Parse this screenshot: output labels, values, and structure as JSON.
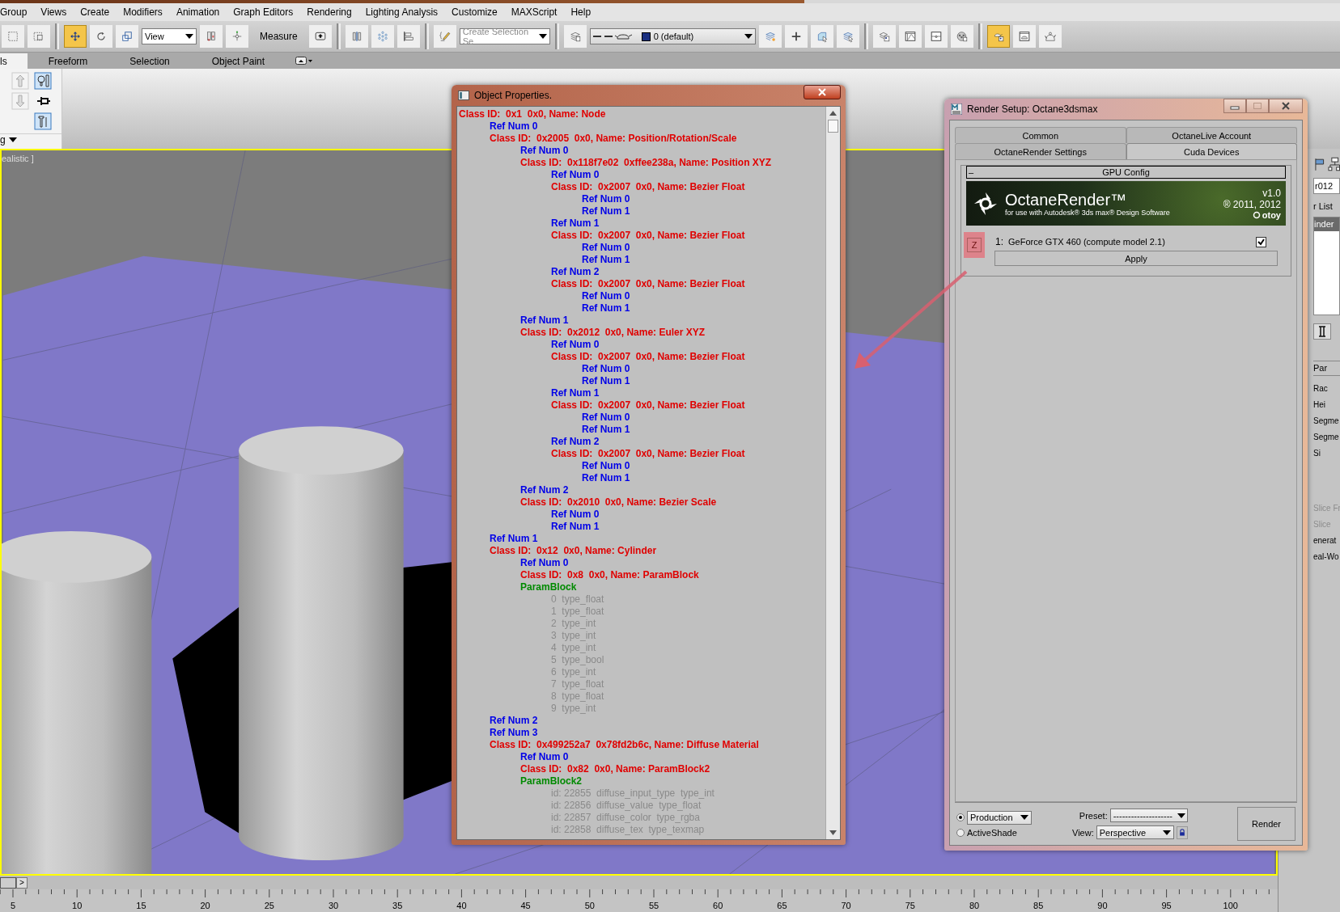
{
  "menu_bar": {
    "items": [
      "Group",
      "Views",
      "Create",
      "Modifiers",
      "Animation",
      "Graph Editors",
      "Rendering",
      "Lighting Analysis",
      "Customize",
      "MAXScript",
      "Help"
    ]
  },
  "main_toolbar": {
    "items": [
      {
        "kind": "icon",
        "selected": false
      },
      {
        "kind": "icon",
        "selected": false
      },
      {
        "kind": "separator"
      },
      {
        "kind": "icon",
        "selected": true
      },
      {
        "kind": "icon",
        "selected": false
      },
      {
        "kind": "icon",
        "selected": false
      },
      {
        "kind": "dropdown",
        "text": "View"
      },
      {
        "kind": "icon",
        "selected": false
      },
      {
        "kind": "icon",
        "selected": false
      },
      {
        "kind": "label",
        "text": "Measure"
      },
      {
        "kind": "icon",
        "selected": false
      },
      {
        "kind": "separator"
      },
      {
        "kind": "icon",
        "selected": false
      },
      {
        "kind": "icon",
        "selected": false
      },
      {
        "kind": "icon",
        "selected": false
      },
      {
        "kind": "separator"
      },
      {
        "kind": "icon",
        "selected": false
      },
      {
        "kind": "dropdown",
        "placeholder": "Create Selection Se"
      },
      {
        "kind": "separator"
      },
      {
        "kind": "icon",
        "selected": false
      },
      {
        "kind": "layer-dropdown",
        "text": "0 (default)"
      },
      {
        "kind": "icon",
        "selected": false
      },
      {
        "kind": "icon",
        "selected": false
      },
      {
        "kind": "icon",
        "selected": false
      },
      {
        "kind": "icon",
        "selected": false
      },
      {
        "kind": "separator"
      },
      {
        "kind": "icon",
        "selected": false
      },
      {
        "kind": "icon",
        "selected": false
      },
      {
        "kind": "icon",
        "selected": false
      },
      {
        "kind": "icon",
        "selected": false
      },
      {
        "kind": "separator"
      },
      {
        "kind": "icon",
        "selected": true
      },
      {
        "kind": "icon",
        "selected": false
      },
      {
        "kind": "icon",
        "selected": false
      }
    ]
  },
  "ribbon": {
    "tabs": [
      {
        "label": "ls",
        "selected": true
      },
      {
        "label": "Freeform",
        "selected": false
      },
      {
        "label": "Selection",
        "selected": false
      },
      {
        "label": "Object Paint",
        "selected": false
      }
    ],
    "panel_label": "g"
  },
  "viewport": {
    "label": "ealistic ]"
  },
  "object_properties": {
    "title": "Object Properties.",
    "tree": [
      {
        "kind": "class",
        "text": "Class ID:  0x1  0x0, Name: Node",
        "children": [
          {
            "kind": "ref",
            "text": "Ref Num 0"
          },
          {
            "kind": "class",
            "text": "Class ID:  0x2005  0x0, Name: Position/Rotation/Scale",
            "children": [
              {
                "kind": "ref",
                "text": "Ref Num 0"
              },
              {
                "kind": "class",
                "text": "Class ID:  0x118f7e02  0xffee238a, Name: Position XYZ",
                "children": [
                  {
                    "kind": "ref",
                    "text": "Ref Num 0"
                  },
                  {
                    "kind": "class",
                    "text": "Class ID:  0x2007  0x0, Name: Bezier Float",
                    "children": [
                      {
                        "kind": "ref",
                        "text": "Ref Num 0"
                      },
                      {
                        "kind": "ref",
                        "text": "Ref Num 1"
                      }
                    ]
                  },
                  {
                    "kind": "ref",
                    "text": "Ref Num 1"
                  },
                  {
                    "kind": "class",
                    "text": "Class ID:  0x2007  0x0, Name: Bezier Float",
                    "children": [
                      {
                        "kind": "ref",
                        "text": "Ref Num 0"
                      },
                      {
                        "kind": "ref",
                        "text": "Ref Num 1"
                      }
                    ]
                  },
                  {
                    "kind": "ref",
                    "text": "Ref Num 2"
                  },
                  {
                    "kind": "class",
                    "text": "Class ID:  0x2007  0x0, Name: Bezier Float",
                    "children": [
                      {
                        "kind": "ref",
                        "text": "Ref Num 0"
                      },
                      {
                        "kind": "ref",
                        "text": "Ref Num 1"
                      }
                    ]
                  }
                ]
              },
              {
                "kind": "ref",
                "text": "Ref Num 1"
              },
              {
                "kind": "class",
                "text": "Class ID:  0x2012  0x0, Name: Euler XYZ",
                "children": [
                  {
                    "kind": "ref",
                    "text": "Ref Num 0"
                  },
                  {
                    "kind": "class",
                    "text": "Class ID:  0x2007  0x0, Name: Bezier Float",
                    "children": [
                      {
                        "kind": "ref",
                        "text": "Ref Num 0"
                      },
                      {
                        "kind": "ref",
                        "text": "Ref Num 1"
                      }
                    ]
                  },
                  {
                    "kind": "ref",
                    "text": "Ref Num 1"
                  },
                  {
                    "kind": "class",
                    "text": "Class ID:  0x2007  0x0, Name: Bezier Float",
                    "children": [
                      {
                        "kind": "ref",
                        "text": "Ref Num 0"
                      },
                      {
                        "kind": "ref",
                        "text": "Ref Num 1"
                      }
                    ]
                  },
                  {
                    "kind": "ref",
                    "text": "Ref Num 2"
                  },
                  {
                    "kind": "class",
                    "text": "Class ID:  0x2007  0x0, Name: Bezier Float",
                    "children": [
                      {
                        "kind": "ref",
                        "text": "Ref Num 0"
                      },
                      {
                        "kind": "ref",
                        "text": "Ref Num 1"
                      }
                    ]
                  }
                ]
              },
              {
                "kind": "ref",
                "text": "Ref Num 2"
              },
              {
                "kind": "class",
                "text": "Class ID:  0x2010  0x0, Name: Bezier Scale",
                "children": [
                  {
                    "kind": "ref",
                    "text": "Ref Num 0"
                  },
                  {
                    "kind": "ref",
                    "text": "Ref Num 1"
                  }
                ]
              }
            ]
          },
          {
            "kind": "ref",
            "text": "Ref Num 1"
          },
          {
            "kind": "class",
            "text": "Class ID:  0x12  0x0, Name: Cylinder",
            "children": [
              {
                "kind": "ref",
                "text": "Ref Num 0"
              },
              {
                "kind": "class",
                "text": "Class ID:  0x8  0x0, Name: ParamBlock"
              },
              {
                "kind": "param",
                "text": "ParamBlock",
                "children": [
                  {
                    "kind": "field",
                    "text": "0  type_float"
                  },
                  {
                    "kind": "field",
                    "text": "1  type_float"
                  },
                  {
                    "kind": "field",
                    "text": "2  type_int"
                  },
                  {
                    "kind": "field",
                    "text": "3  type_int"
                  },
                  {
                    "kind": "field",
                    "text": "4  type_int"
                  },
                  {
                    "kind": "field",
                    "text": "5  type_bool"
                  },
                  {
                    "kind": "field",
                    "text": "6  type_int"
                  },
                  {
                    "kind": "field",
                    "text": "7  type_float"
                  },
                  {
                    "kind": "field",
                    "text": "8  type_float"
                  },
                  {
                    "kind": "field",
                    "text": "9  type_int"
                  }
                ]
              }
            ]
          },
          {
            "kind": "ref",
            "text": "Ref Num 2"
          },
          {
            "kind": "ref",
            "text": "Ref Num 3"
          },
          {
            "kind": "class",
            "text": "Class ID:  0x499252a7  0x78fd2b6c, Name: Diffuse Material",
            "children": [
              {
                "kind": "ref",
                "text": "Ref Num 0"
              },
              {
                "kind": "class",
                "text": "Class ID:  0x82  0x0, Name: ParamBlock2"
              },
              {
                "kind": "param",
                "text": "ParamBlock2",
                "children": [
                  {
                    "kind": "field",
                    "text": "id: 22855  diffuse_input_type  type_int"
                  },
                  {
                    "kind": "field",
                    "text": "id: 22856  diffuse_value  type_float"
                  },
                  {
                    "kind": "field",
                    "text": "id: 22857  diffuse_color  type_rgba"
                  },
                  {
                    "kind": "field",
                    "text": "id: 22858  diffuse_tex  type_texmap"
                  }
                ]
              }
            ]
          }
        ]
      }
    ]
  },
  "render_setup": {
    "title": "Render Setup: Octane3dsmax",
    "tab_rows": [
      {
        "tabs": [
          {
            "label": "Common",
            "selected": false
          },
          {
            "label": "OctaneLive Account",
            "selected": false
          }
        ]
      },
      {
        "tabs": [
          {
            "label": "OctaneRender Settings",
            "selected": false
          },
          {
            "label": "Cuda Devices",
            "selected": true
          }
        ]
      }
    ],
    "rollout": {
      "collapse": "–",
      "title": "GPU Config",
      "banner": {
        "product": "OctaneRender™",
        "subtitle": "for use with Autodesk® 3ds max® Design Software",
        "version": "v1.0",
        "copyright": "® 2011, 2012",
        "company": "otoy"
      },
      "devices": [
        {
          "index": "1:",
          "name": "GeForce GTX 460 (compute model 2.1)",
          "checked": true
        }
      ],
      "apply": "Apply"
    },
    "annotation": {
      "label": "Z"
    },
    "modes": [
      {
        "kind": "dropdown",
        "label": "Production",
        "selected": true
      },
      {
        "kind": "text",
        "label": "ActiveShade",
        "selected": false
      }
    ],
    "preset": {
      "label": "Preset:",
      "value": "--------------------"
    },
    "view": {
      "label": "View:",
      "value": "Perspective"
    },
    "render_button": "Render"
  },
  "command_panel": {
    "items": [
      {
        "kind": "field",
        "text": "r012"
      },
      {
        "kind": "label",
        "text": "r List"
      },
      {
        "kind": "list-selected",
        "text": "inder"
      },
      {
        "kind": "header",
        "text": "Par"
      },
      {
        "kind": "param",
        "text": "Rac"
      },
      {
        "kind": "param",
        "text": "Hei"
      },
      {
        "kind": "param",
        "text": "Segme"
      },
      {
        "kind": "param",
        "text": "Segme"
      },
      {
        "kind": "param",
        "text": "Si"
      },
      {
        "kind": "disabled",
        "text": "Slice Fr"
      },
      {
        "kind": "disabled",
        "text": "Slice"
      },
      {
        "kind": "param",
        "text": "enerat"
      },
      {
        "kind": "param",
        "text": "eal-Wo"
      }
    ]
  },
  "time_slider": {
    "next": ">"
  },
  "ruler": {
    "labels": [
      "5",
      "10",
      "15",
      "20",
      "25",
      "30",
      "35",
      "40",
      "45",
      "50",
      "55",
      "60",
      "65",
      "70",
      "75",
      "80",
      "85",
      "90",
      "95",
      "100"
    ]
  }
}
